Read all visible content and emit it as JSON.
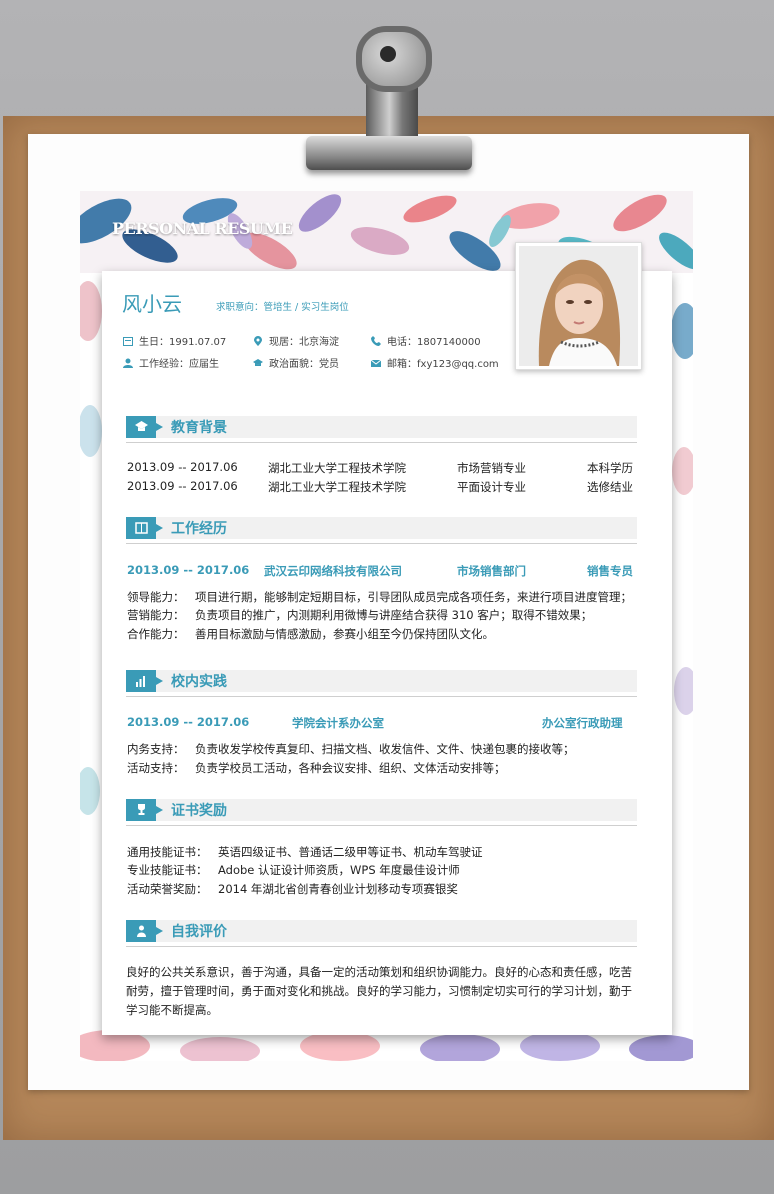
{
  "banner_title": "PERSONAL RESUME",
  "header": {
    "name": "风小云",
    "intent": "求职意向：管培生 / 实习生岗位",
    "info": {
      "birth": "生日：1991.07.07",
      "location": "现居：北京海淀",
      "phone": "电话：1807140000",
      "experience": "工作经验：应届生",
      "political": "政治面貌：党员",
      "email": "邮箱：fxy123@qq.com"
    }
  },
  "sections": {
    "education": {
      "title": "教育背景",
      "rows": [
        {
          "date": "2013.09 -- 2017.06",
          "school": "湖北工业大学工程技术学院",
          "major": "市场营销专业",
          "degree": "本科学历"
        },
        {
          "date": "2013.09 -- 2017.06",
          "school": "湖北工业大学工程技术学院",
          "major": "平面设计专业",
          "degree": "选修结业"
        }
      ]
    },
    "work": {
      "title": "工作经历",
      "date": "2013.09 -- 2017.06",
      "company": "武汉云印网络科技有限公司",
      "dept": "市场销售部门",
      "role": "销售专员",
      "items": [
        {
          "label": "领导能力：",
          "text": "项目进行期，能够制定短期目标，引导团队成员完成各项任务，来进行项目进度管理；"
        },
        {
          "label": "营销能力：",
          "text": "负责项目的推广，内测期利用微博与讲座结合获得 310 客户；取得不错效果；"
        },
        {
          "label": "合作能力：",
          "text": "善用目标激励与情感激励，参赛小组至今仍保持团队文化。"
        }
      ]
    },
    "campus": {
      "title": "校内实践",
      "date": "2013.09 -- 2017.06",
      "org": "学院会计系办公室",
      "role": "办公室行政助理",
      "items": [
        {
          "label": "内务支持：",
          "text": "负责收发学校传真复印、扫描文档、收发信件、文件、快递包裹的接收等；"
        },
        {
          "label": "活动支持：",
          "text": "负责学校员工活动，各种会议安排、组织、文体活动安排等；"
        }
      ]
    },
    "certs": {
      "title": "证书奖励",
      "items": [
        {
          "label": "通用技能证书：",
          "text": "英语四级证书、普通话二级甲等证书、机动车驾驶证"
        },
        {
          "label": "专业技能证书：",
          "text": "Adobe 认证设计师资质，WPS 年度最佳设计师"
        },
        {
          "label": "活动荣誉奖励：",
          "text": "2014 年湖北省创青春创业计划移动专项赛银奖"
        }
      ]
    },
    "self": {
      "title": "自我评价",
      "text": "良好的公共关系意识，善于沟通，具备一定的活动策划和组织协调能力。良好的心态和责任感，吃苦耐劳，擅于管理时间，勇于面对变化和挑战。良好的学习能力，习惯制定切实可行的学习计划，勤于学习能不断提高。"
    }
  },
  "colors": {
    "accent": "#3a9bb7",
    "board": "#b5875a"
  }
}
